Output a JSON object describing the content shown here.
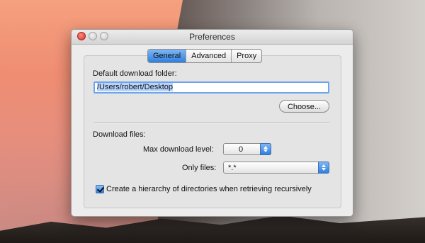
{
  "window": {
    "title": "Preferences"
  },
  "tabs": [
    {
      "label": "General",
      "selected": true
    },
    {
      "label": "Advanced",
      "selected": false
    },
    {
      "label": "Proxy",
      "selected": false
    }
  ],
  "general": {
    "download_folder_label": "Default download folder:",
    "download_folder_value": "/Users/robert/Desktop",
    "choose_button": "Choose...",
    "download_files_label": "Download files:",
    "max_level_label": "Max download level:",
    "max_level_value": "0",
    "only_files_label": "Only files:",
    "only_files_value": "*.*",
    "hierarchy_checkbox_label": "Create a hierarchy of directories when retrieving recursively",
    "hierarchy_checked": true
  },
  "colors": {
    "accent": "#2f7fe0",
    "close": "#d9362e"
  },
  "icons": {
    "popup": "up-down-arrows-icon",
    "check": "checkmark-icon"
  }
}
